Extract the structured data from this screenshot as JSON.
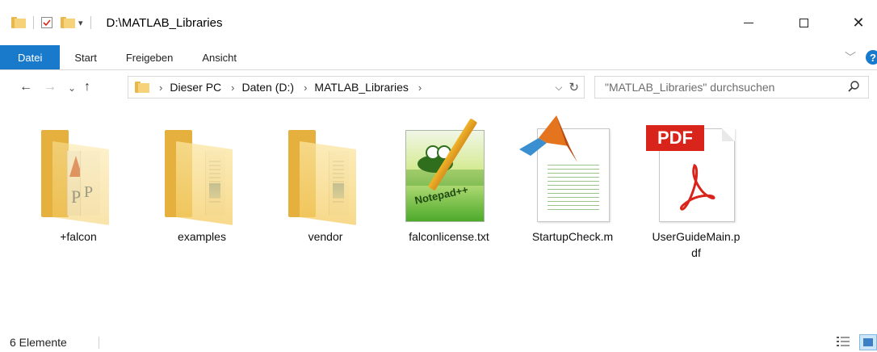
{
  "window": {
    "title": "D:\\MATLAB_Libraries",
    "close_glyph": "✕"
  },
  "ribbon": {
    "tabs": [
      "Datei",
      "Start",
      "Freigeben",
      "Ansicht"
    ],
    "help_glyph": "?"
  },
  "nav": {
    "back_glyph": "←",
    "forward_glyph": "→",
    "recent_glyph": "⌄",
    "up_glyph": "↑",
    "breadcrumbs": [
      "Dieser PC",
      "Daten (D:)",
      "MATLAB_Libraries"
    ],
    "search_placeholder": "\"MATLAB_Libraries\" durchsuchen"
  },
  "items": [
    {
      "name": "+falcon",
      "type": "folder",
      "icon": "folder-icon"
    },
    {
      "name": "examples",
      "type": "folder",
      "icon": "folder-icon"
    },
    {
      "name": "vendor",
      "type": "folder",
      "icon": "folder-icon"
    },
    {
      "name": "falconlicense.txt",
      "type": "file",
      "icon": "notepadpp-file-icon",
      "icon_text": "Notepad++"
    },
    {
      "name": "StartupCheck.m",
      "type": "file",
      "icon": "matlab-file-icon"
    },
    {
      "name": "UserGuideMain.p\ndf",
      "type": "file",
      "icon": "pdf-file-icon",
      "icon_text": "PDF"
    }
  ],
  "status": {
    "item_count": "6 Elemente"
  },
  "colors": {
    "accent": "#1979ca",
    "folder": "#f4cd66",
    "pdf_red": "#d9241b"
  }
}
